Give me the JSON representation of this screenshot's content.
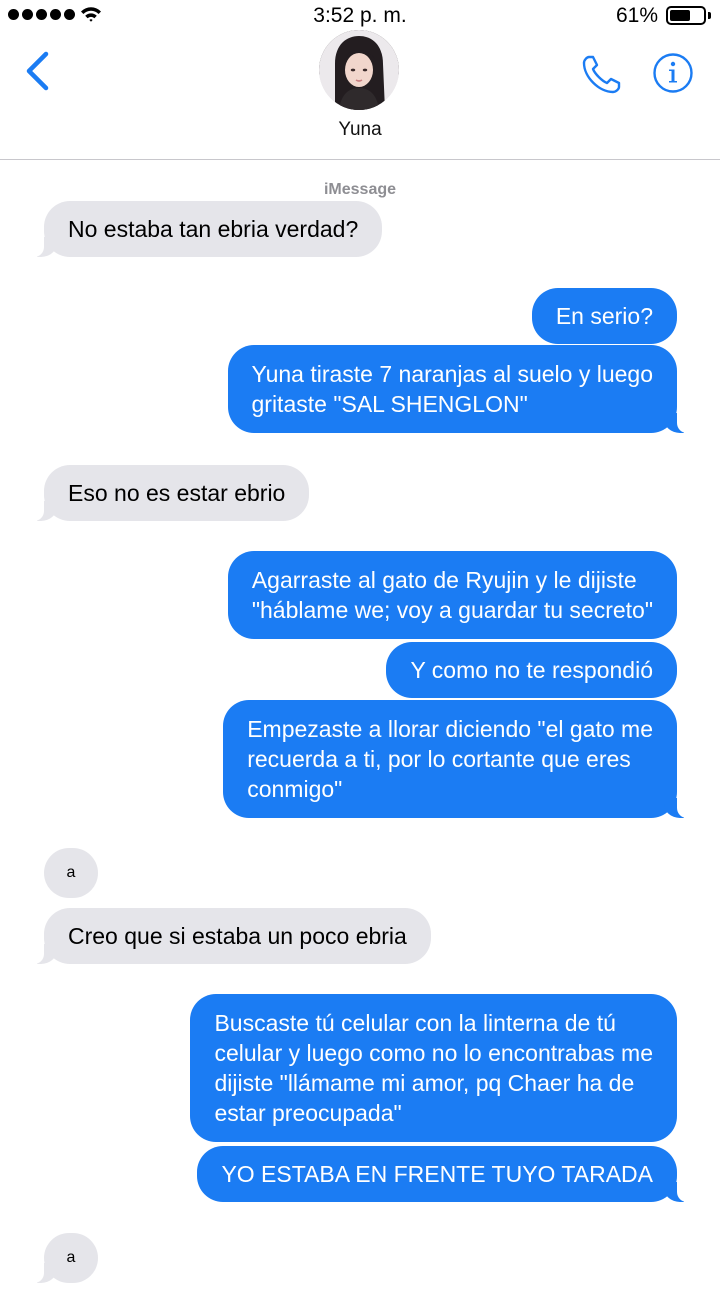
{
  "status_bar": {
    "time": "3:52 p. m.",
    "battery_percent": "61%",
    "battery_level": 0.61,
    "signal_bars": 5
  },
  "header": {
    "contact_name": "Yuna",
    "back_icon": "chevron-left-icon",
    "phone_icon": "phone-icon",
    "info_icon": "info-icon",
    "accent_color": "#1b7cf3"
  },
  "service_label": "iMessage",
  "colors": {
    "incoming_bubble": "#e5e5ea",
    "outgoing_bubble": "#1b7cf3"
  },
  "messages": [
    {
      "from": "them",
      "lines": [
        "No estaba tan ebria verdad?"
      ]
    },
    {
      "from": "me",
      "lines": [
        "En serio?"
      ]
    },
    {
      "from": "me",
      "lines": [
        "Yuna tiraste 7 naranjas al suelo y luego",
        "gritaste \"SAL SHENGLON\""
      ]
    },
    {
      "from": "them",
      "lines": [
        "Eso no es estar ebrio"
      ]
    },
    {
      "from": "me",
      "lines": [
        "Agarraste al gato de Ryujin y le dijiste",
        "\"háblame we; voy a guardar tu secreto\""
      ]
    },
    {
      "from": "me",
      "lines": [
        "Y como no te respondió"
      ]
    },
    {
      "from": "me",
      "lines": [
        "Empezaste a llorar diciendo \"el gato me",
        "recuerda a ti, por lo cortante que eres",
        "conmigo\""
      ]
    },
    {
      "from": "them",
      "lines": [
        "a"
      ]
    },
    {
      "from": "them",
      "lines": [
        "Creo que si estaba un poco ebria"
      ]
    },
    {
      "from": "me",
      "lines": [
        "Buscaste tú celular con la linterna de tú",
        "celular y luego como no lo encontrabas me",
        "dijiste \"llámame mi amor, pq Chaer ha de",
        "estar preocupada\""
      ]
    },
    {
      "from": "me",
      "lines": [
        "YO ESTABA EN FRENTE TUYO TARADA"
      ]
    },
    {
      "from": "them",
      "lines": [
        "a"
      ]
    }
  ]
}
